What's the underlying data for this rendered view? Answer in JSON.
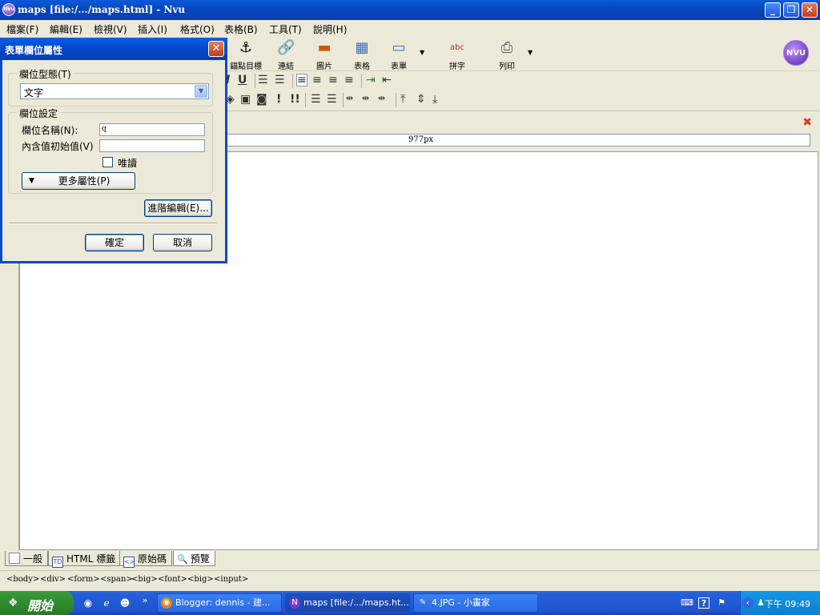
{
  "window": {
    "title": "maps [file:/.../maps.html] - Nvu",
    "app_icon": "Nvu"
  },
  "menu": [
    "檔案(F)",
    "編輯(E)",
    "檢視(V)",
    "插入(I)",
    "格式(O)",
    "表格(B)",
    "工具(T)",
    "說明(H)"
  ],
  "toolbar": {
    "items": [
      {
        "label": "錨點目標",
        "icon": "anchor-icon",
        "glyph": "⚓"
      },
      {
        "label": "連結",
        "icon": "link-icon",
        "glyph": "🔗"
      },
      {
        "label": "圖片",
        "icon": "image-icon",
        "glyph": "▬"
      },
      {
        "label": "表格",
        "icon": "table-icon",
        "glyph": "▦"
      },
      {
        "label": "表單",
        "icon": "form-icon",
        "glyph": "▭"
      },
      {
        "label": "拼字",
        "icon": "spellcheck-icon",
        "glyph": "abc"
      },
      {
        "label": "列印",
        "icon": "print-icon",
        "glyph": "⎙"
      }
    ],
    "logo": "NVU"
  },
  "ruler": {
    "width_label": "977px"
  },
  "mode_tabs": [
    {
      "label": "一般",
      "icon": "page-icon"
    },
    {
      "label": "HTML 標籤",
      "icon": "html-tag-icon",
      "glyph": "TD"
    },
    {
      "label": "原始碼",
      "icon": "source-icon",
      "glyph": "<>"
    },
    {
      "label": "預覽",
      "icon": "preview-icon",
      "glyph": "🔍"
    }
  ],
  "status_path": [
    "<body>",
    "<div>",
    "<form>",
    "<span>",
    "<big>",
    "<font>",
    "<big>",
    "<input>"
  ],
  "dialog": {
    "title": "表單欄位屬性",
    "field_type_group": "欄位型態(T)",
    "field_type_value": "文字",
    "settings_group": "欄位設定",
    "name_label": "欄位名稱(N):",
    "name_value": "q",
    "initial_label": "內含值初始值(V)",
    "initial_value": "",
    "readonly_label": "唯讀",
    "more_button": "更多屬性(P)",
    "advanced_button": "進階編輯(E)...",
    "ok_button": "確定",
    "cancel_button": "取消"
  },
  "taskbar": {
    "start": "開始",
    "tasks": [
      {
        "label": "Blogger: dennis - 建...",
        "icon": "firefox-icon"
      },
      {
        "label": "maps [file:/.../maps.ht...",
        "icon": "nvu-icon"
      },
      {
        "label": "4.JPG - 小畫家",
        "icon": "paint-icon"
      }
    ],
    "clock": "下午 09:49"
  }
}
